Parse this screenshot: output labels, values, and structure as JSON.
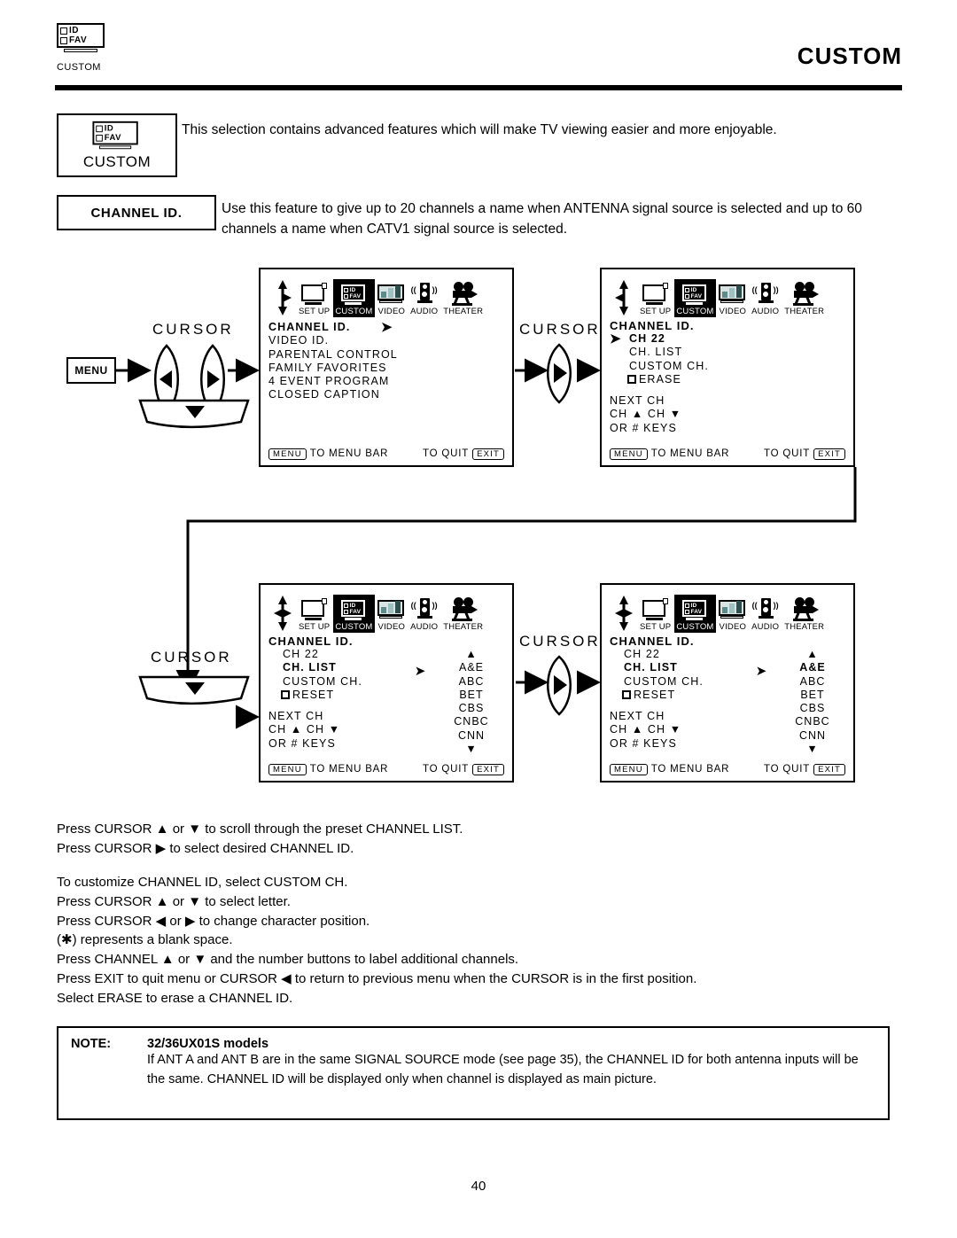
{
  "header": {
    "icon_id_label": "ID",
    "icon_fav_label": "FAV",
    "icon_caption": "CUSTOM",
    "title": "CUSTOM"
  },
  "intro": {
    "box_id_label": "ID",
    "box_fav_label": "FAV",
    "box_caption": "CUSTOM",
    "text": "This selection contains advanced features which will make TV viewing easier and more enjoyable."
  },
  "feature": {
    "label": "CHANNEL ID.",
    "text": "Use this feature to give up to 20 channels a name when ANTENNA signal source is selected and up to 60 channels a name when CATV1 signal source is selected."
  },
  "controls": {
    "menu_button": "MENU",
    "cursor_label_1": "CURSOR",
    "cursor_label_2": "CURSOR",
    "cursor_label_3": "CURSOR",
    "cursor_label_4": "CURSOR"
  },
  "menubar": {
    "items": [
      {
        "name": "SET UP",
        "icon": "monitor-icon",
        "selected": false
      },
      {
        "name": "CUSTOM",
        "icon": "id-fav-tv-icon",
        "selected": true
      },
      {
        "name": "VIDEO",
        "icon": "video-monitor-icon",
        "selected": false
      },
      {
        "name": "AUDIO",
        "icon": "speaker-icon",
        "selected": false
      },
      {
        "name": "THEATER",
        "icon": "movie-camera-icon",
        "selected": false
      }
    ]
  },
  "osd_common": {
    "menu_key": "MENU",
    "menu_hint": "TO MENU BAR",
    "quit_hint": "TO QUIT",
    "exit_key": "EXIT",
    "title": "CHANNEL ID."
  },
  "panels": [
    {
      "id": "panel-custom-menu",
      "nav": "up-right-down",
      "title": "CHANNEL ID.",
      "items": [
        {
          "label": "CHANNEL ID.",
          "bold": true,
          "arrow": true
        },
        {
          "label": "VIDEO ID.",
          "bold": false,
          "arrow": false
        },
        {
          "label": "PARENTAL CONTROL",
          "bold": false,
          "arrow": false
        },
        {
          "label": "FAMILY FAVORITES",
          "bold": false,
          "arrow": false
        },
        {
          "label": "4 EVENT PROGRAM",
          "bold": false,
          "arrow": false
        },
        {
          "label": "CLOSED CAPTION",
          "bold": false,
          "arrow": false
        }
      ],
      "footer_lines": []
    },
    {
      "id": "panel-channel-id",
      "nav": "up-left-down",
      "title": "CHANNEL ID.",
      "items": [
        {
          "label": "CH 22",
          "bold": true,
          "arrow": true,
          "indent": true
        },
        {
          "label": "CH. LIST",
          "bold": false,
          "arrow": false,
          "indent": true
        },
        {
          "label": "CUSTOM CH.",
          "bold": false,
          "arrow": false,
          "indent": true
        },
        {
          "label": "ERASE",
          "bold": false,
          "arrow": false,
          "indent": true,
          "checkbox": true
        }
      ],
      "footer_lines": [
        "NEXT CH",
        "CH ▲ CH ▼",
        "OR # KEYS"
      ]
    },
    {
      "id": "panel-ch-list",
      "nav": "four-way",
      "title": "CHANNEL ID.",
      "items": [
        {
          "label": "CH 22",
          "bold": false,
          "arrow": false,
          "indent": true
        },
        {
          "label": "CH. LIST",
          "bold": true,
          "arrow": true,
          "indent": true
        },
        {
          "label": "CUSTOM CH.",
          "bold": false,
          "arrow": false,
          "indent": true
        },
        {
          "label": "RESET",
          "bold": false,
          "arrow": false,
          "indent": true,
          "checkbox": true
        }
      ],
      "footer_lines": [
        "NEXT CH",
        "CH ▲ CH ▼",
        "OR # KEYS"
      ],
      "channel_list": {
        "scroll_up": "▲",
        "entries": [
          {
            "name": "A&E",
            "bold": false
          },
          {
            "name": "ABC",
            "bold": false
          },
          {
            "name": "BET",
            "bold": false
          },
          {
            "name": "CBS",
            "bold": false
          },
          {
            "name": "CNBC",
            "bold": false
          },
          {
            "name": "CNN",
            "bold": false
          }
        ],
        "scroll_down": "▼"
      }
    },
    {
      "id": "panel-ch-list-selected",
      "nav": "up-left-right-down",
      "title": "CHANNEL ID.",
      "items": [
        {
          "label": "CH 22",
          "bold": false,
          "arrow": false,
          "indent": true
        },
        {
          "label": "CH. LIST",
          "bold": true,
          "arrow": true,
          "indent": true
        },
        {
          "label": "CUSTOM CH.",
          "bold": false,
          "arrow": false,
          "indent": true
        },
        {
          "label": "RESET",
          "bold": false,
          "arrow": false,
          "indent": true,
          "checkbox": true
        }
      ],
      "footer_lines": [
        "NEXT CH",
        "CH ▲ CH ▼",
        "OR # KEYS"
      ],
      "channel_list": {
        "scroll_up": "▲",
        "entries": [
          {
            "name": "A&E",
            "bold": true
          },
          {
            "name": "ABC",
            "bold": false
          },
          {
            "name": "BET",
            "bold": false
          },
          {
            "name": "CBS",
            "bold": false
          },
          {
            "name": "CNBC",
            "bold": false
          },
          {
            "name": "CNN",
            "bold": false
          }
        ],
        "scroll_down": "▼"
      }
    }
  ],
  "instructions": {
    "group1": [
      "Press CURSOR ▲ or ▼ to scroll through the preset CHANNEL LIST.",
      "Press CURSOR ▶ to select desired CHANNEL ID."
    ],
    "group2": [
      "To customize CHANNEL ID, select CUSTOM CH.",
      "Press CURSOR ▲ or ▼ to select letter.",
      "Press CURSOR ◀ or ▶ to change character position.",
      "(✱) represents a blank space.",
      "Press CHANNEL ▲ or ▼  and the number buttons to label additional channels.",
      "Press EXIT to quit menu or CURSOR ◀ to return to previous menu when the CURSOR is in the first position.",
      "Select ERASE to erase a CHANNEL ID."
    ]
  },
  "note": {
    "label": "NOTE:",
    "models": "32/36UX01S models",
    "body": "If ANT A and ANT B are in the same SIGNAL SOURCE mode (see page 35), the CHANNEL ID for both antenna inputs will be the same.   CHANNEL ID will be displayed only when channel is displayed as main picture."
  },
  "page_number": "40"
}
